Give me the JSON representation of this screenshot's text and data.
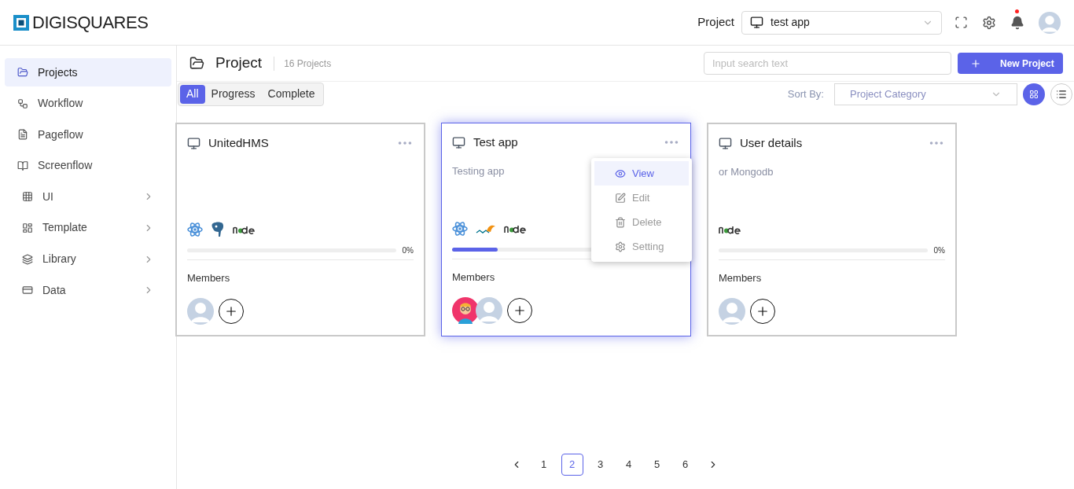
{
  "brand": {
    "name": "DIGISQUARES"
  },
  "topbar": {
    "label": "Project",
    "project_select": {
      "value": "test app"
    },
    "notification_dot": true
  },
  "sidebar": {
    "items": [
      {
        "label": "Projects",
        "kind": "projects",
        "selected": true,
        "expandable": false
      },
      {
        "label": "Workflow",
        "kind": "workflow",
        "selected": false,
        "expandable": false
      },
      {
        "label": "Pageflow",
        "kind": "pageflow",
        "selected": false,
        "expandable": false
      },
      {
        "label": "Screenflow",
        "kind": "screenflow",
        "selected": false,
        "expandable": false
      },
      {
        "label": "UI",
        "kind": "ui",
        "selected": false,
        "expandable": true
      },
      {
        "label": "Template",
        "kind": "template",
        "selected": false,
        "expandable": true
      },
      {
        "label": "Library",
        "kind": "library",
        "selected": false,
        "expandable": true
      },
      {
        "label": "Data",
        "kind": "data",
        "selected": false,
        "expandable": true
      }
    ]
  },
  "page": {
    "title": "Project",
    "count": "16 Projects",
    "search": {
      "placeholder": "Input search text"
    },
    "new_button": "New Project"
  },
  "filters": [
    {
      "label": "All",
      "selected": true
    },
    {
      "label": "Progress",
      "selected": false
    },
    {
      "label": "Complete",
      "selected": false
    }
  ],
  "sort": {
    "label": "Sort By:",
    "placeholder": "Project Category"
  },
  "view_toggle": [
    {
      "kind": "grid",
      "selected": true
    },
    {
      "kind": "list",
      "selected": false
    }
  ],
  "cards": [
    {
      "name": "UnitedHMS",
      "highlighted": false,
      "stack": [
        {
          "kind": "react"
        },
        {
          "kind": "postgres"
        },
        {
          "kind": "node"
        }
      ],
      "percent": "0%",
      "members_label": "Members",
      "members": [
        {
          "kind": "default"
        }
      ]
    },
    {
      "name": "Test app",
      "description": "Testing app",
      "highlighted": true,
      "stack": [
        {
          "kind": "react"
        },
        {
          "kind": "mysql"
        },
        {
          "kind": "node"
        }
      ],
      "level": 0.2,
      "members_label": "Members",
      "members": [
        {
          "kind": "illustrated"
        },
        {
          "kind": "default"
        }
      ],
      "menu": [
        {
          "label": "View",
          "kind": "view",
          "selected": true
        },
        {
          "label": "Edit",
          "kind": "edit",
          "selected": false
        },
        {
          "label": "Delete",
          "kind": "delete",
          "selected": false
        },
        {
          "label": "Setting",
          "kind": "setting",
          "selected": false
        }
      ]
    },
    {
      "name": "User details",
      "description": "or Mongodb",
      "highlighted": false,
      "stack": [
        {
          "kind": "node"
        }
      ],
      "percent": "0%",
      "members_label": "Members",
      "members": [
        {
          "kind": "default"
        }
      ]
    }
  ],
  "pagination": {
    "pages": [
      {
        "label": "1",
        "selected": false
      },
      {
        "label": "2",
        "selected": true
      },
      {
        "label": "3",
        "selected": false
      },
      {
        "label": "4",
        "selected": false
      },
      {
        "label": "5",
        "selected": false
      },
      {
        "label": "6",
        "selected": false
      }
    ]
  }
}
